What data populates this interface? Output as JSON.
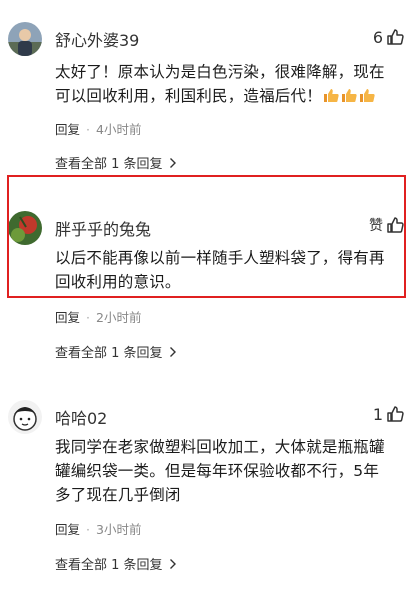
{
  "comments": [
    {
      "username": "舒心外婆39",
      "likes": "6",
      "lines": [
        "太好了！原本认为是白色污染，很难降解，现在",
        "可以回收利用，利国利民，造福后代！"
      ],
      "emoji": "thumbs-up-emoji",
      "emoji_count": 3,
      "reply_label": "回复",
      "time": "4小时前",
      "view_all": "查看全部 1 条回复"
    },
    {
      "username": "胖乎乎的兔兔",
      "likes": "赞",
      "lines": [
        "以后不能再像以前一样随手人塑料袋了，得有再",
        "回收利用的意识。"
      ],
      "reply_label": "回复",
      "time": "2小时前",
      "view_all": "查看全部 1 条回复"
    },
    {
      "username": "哈哈02",
      "likes": "1",
      "lines": [
        "我同学在老家做塑料回收加工，大体就是瓶瓶罐",
        "罐编织袋一类。但是每年环保验收都不行，5年",
        "多了现在几乎倒闭"
      ],
      "reply_label": "回复",
      "time": "3小时前",
      "view_all": "查看全部 1 条回复"
    }
  ],
  "colors": {
    "highlight_border": "#e02020",
    "meta_text": "#888888",
    "emoji_yellow": "#f6b545"
  }
}
